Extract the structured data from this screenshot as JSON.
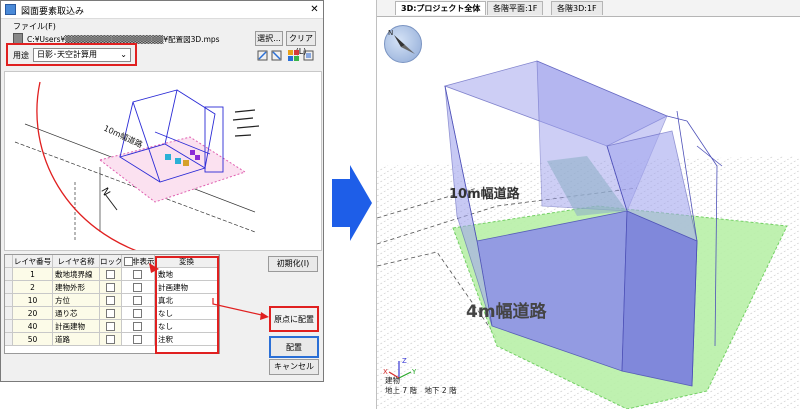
{
  "dialog": {
    "title": "図面要素取込み",
    "close_glyph": "✕",
    "file_label": "ファイル(F)",
    "file_path": "C:¥Users¥▒▒▒▒▒▒▒▒▒▒▒▒▒▒▒▒▒¥配置図3D.mps",
    "select_button": "選択...",
    "clear_button": "クリア(L)",
    "usage_label": "用途",
    "usage_value": "日影･天空計算用",
    "usage_chevron": "⌄"
  },
  "layer_table": {
    "headers": [
      "レイヤ番号",
      "レイヤ名称",
      "ロック",
      "非表示",
      "変換"
    ],
    "rows": [
      {
        "num": "1",
        "name": "敷地境界線",
        "mapping": "敷地"
      },
      {
        "num": "2",
        "name": "建物外形",
        "mapping": "計画建物"
      },
      {
        "num": "10",
        "name": "方位",
        "mapping": "真北"
      },
      {
        "num": "20",
        "name": "通り芯",
        "mapping": "なし"
      },
      {
        "num": "40",
        "name": "計画建物",
        "mapping": "なし"
      },
      {
        "num": "50",
        "name": "道路",
        "mapping": "注釈"
      }
    ]
  },
  "buttons": {
    "init": "初期化(I)",
    "origin": "原点に配置",
    "place": "配置",
    "cancel": "キャンセル"
  },
  "preview": {
    "road_label": "10m幅道路",
    "north_label": "N"
  },
  "view3d": {
    "tabs": [
      "3D:プロジェクト全体",
      "各階平面:1F",
      "各階3D:1F"
    ],
    "road_10m_label": "10m幅道路",
    "road_4m_label": "4m幅道路",
    "compass_label": "N",
    "axis_info": [
      "建物",
      "地上 7 階　地下 2 階"
    ],
    "axis_letters": [
      "Z",
      "Y",
      "X"
    ]
  },
  "colors": {
    "highlight_red": "#e02020",
    "arrow_blue": "#1e5ee8",
    "building_fill": "#8f92e8",
    "site_green": "#b9f0a8"
  }
}
